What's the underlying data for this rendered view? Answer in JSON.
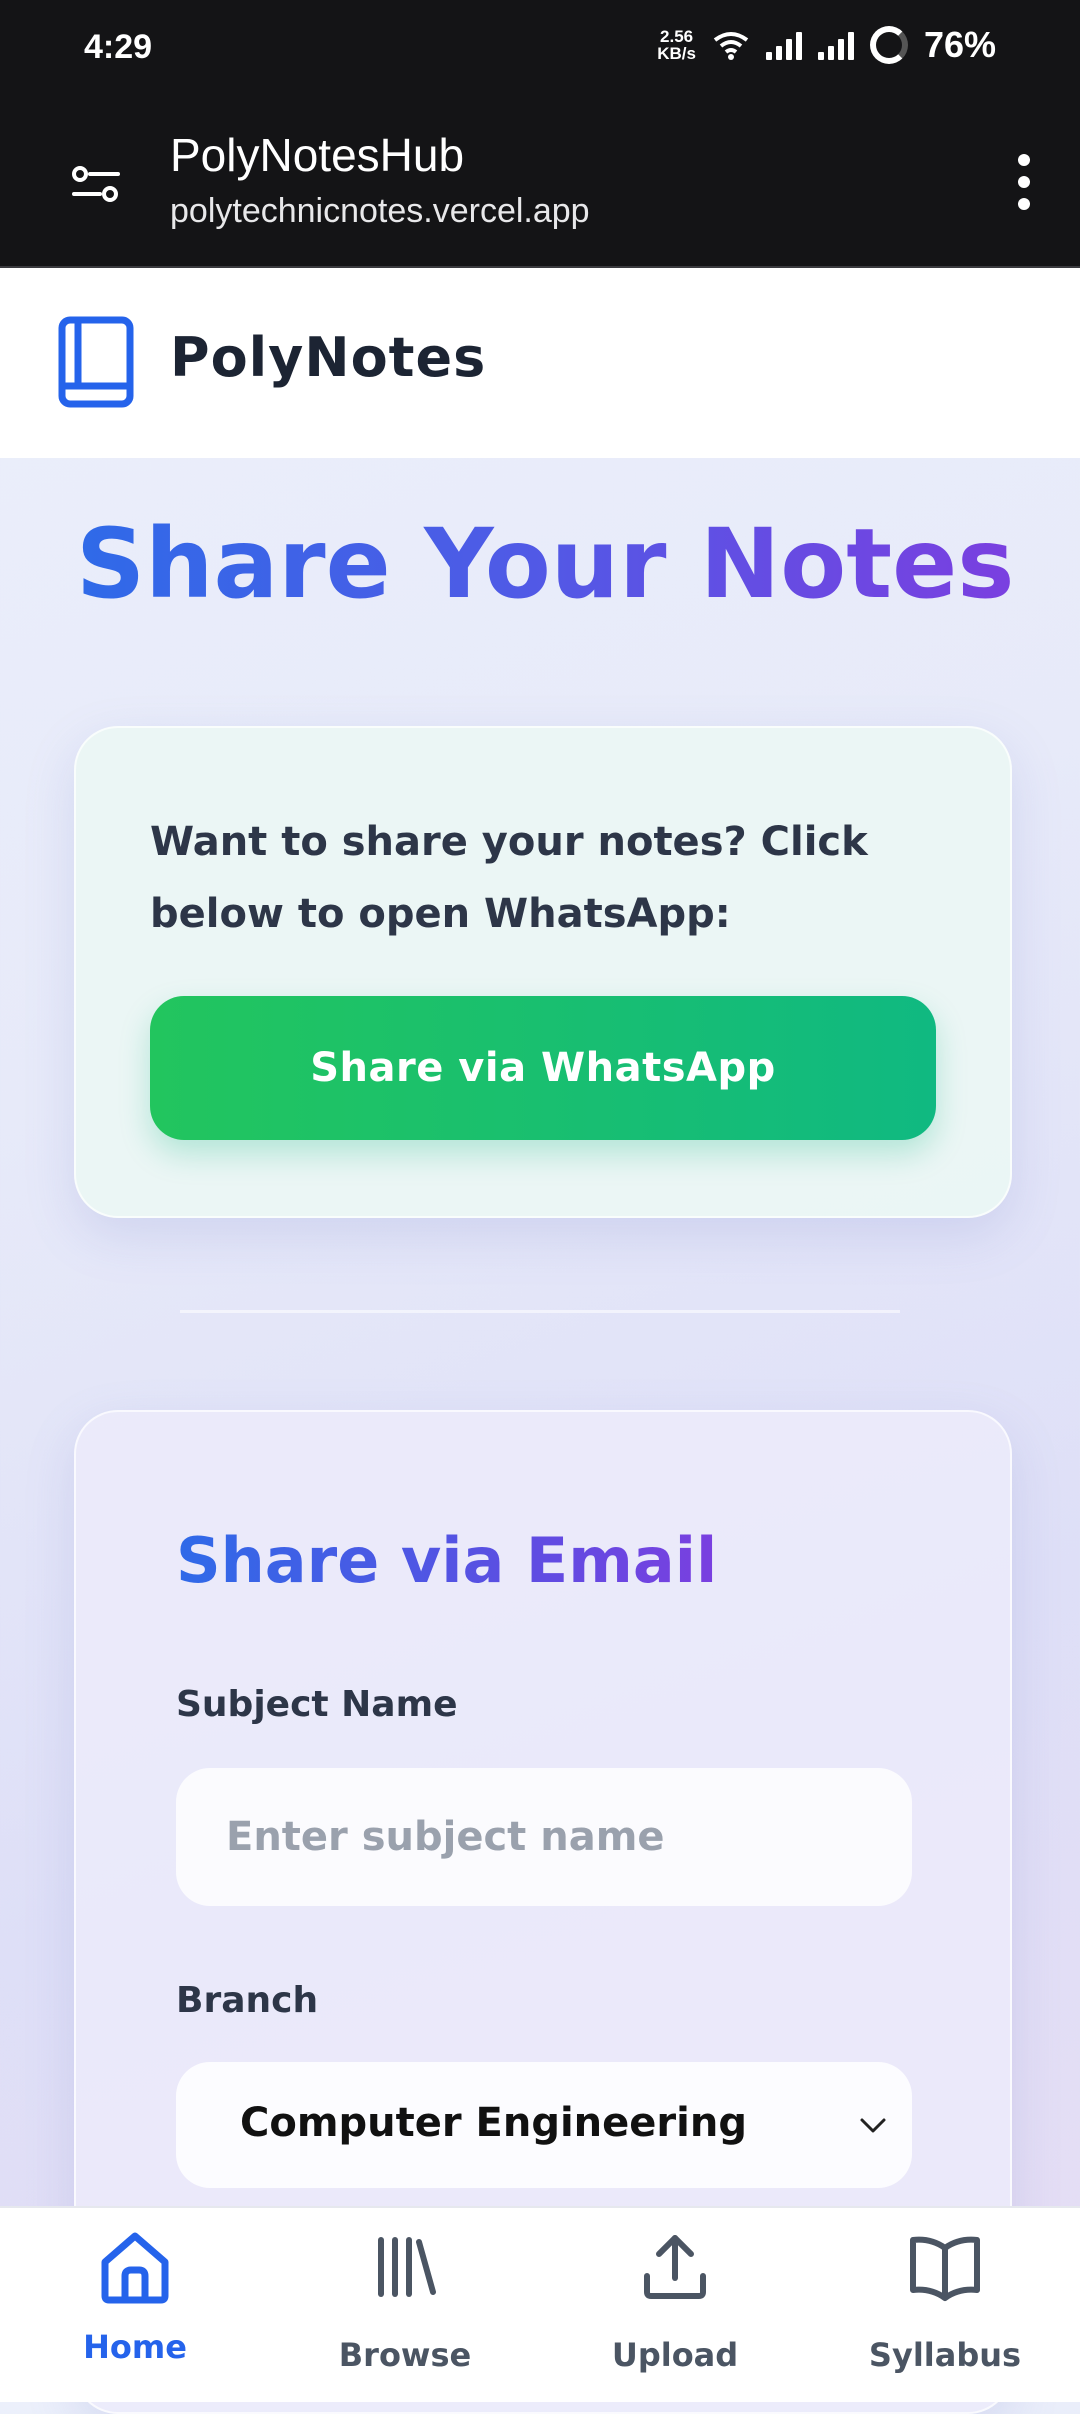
{
  "status_bar": {
    "time": "4:29",
    "net_speed_value": "2.56",
    "net_speed_unit": "KB/s",
    "battery": "76%"
  },
  "browser": {
    "title": "PolyNotesHub",
    "url": "polytechnicnotes.vercel.app"
  },
  "header": {
    "brand": "PolyNotes",
    "logo_icon": "book-icon"
  },
  "page": {
    "title": "Share Your Notes"
  },
  "whatsapp_card": {
    "text": "Want to share your notes? Click below to open WhatsApp:",
    "button_label": "Share via WhatsApp"
  },
  "email_card": {
    "title": "Share via Email",
    "subject_label": "Subject Name",
    "subject_placeholder": "Enter subject name",
    "subject_value": "",
    "branch_label": "Branch",
    "branch_value": "Computer Engineering"
  },
  "bottom_nav": {
    "items": [
      {
        "label": "Home",
        "icon": "home-icon",
        "active": true
      },
      {
        "label": "Browse",
        "icon": "library-icon",
        "active": false
      },
      {
        "label": "Upload",
        "icon": "upload-icon",
        "active": false
      },
      {
        "label": "Syllabus",
        "icon": "open-book-icon",
        "active": false
      }
    ]
  },
  "colors": {
    "accent_blue": "#2563eb",
    "accent_purple": "#7a3fe0",
    "whatsapp_green": "#22c55e",
    "text_dark": "#2d3648"
  }
}
